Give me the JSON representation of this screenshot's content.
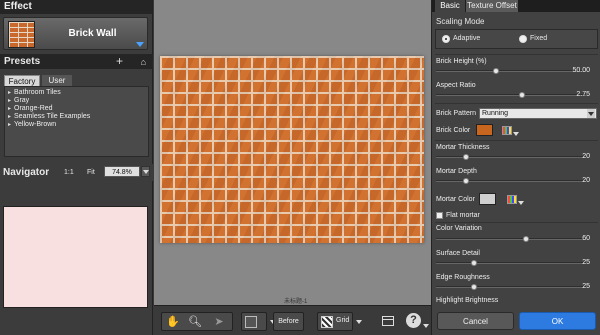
{
  "effect": {
    "section_title": "Effect",
    "name": "Brick Wall"
  },
  "presets": {
    "section_title": "Presets",
    "tabs": [
      "Factory",
      "User"
    ],
    "items": [
      "Bathroom Tiles",
      "Gray",
      "Orange-Red",
      "Seamless Tile Examples",
      "Yellow-Brown"
    ]
  },
  "navigator": {
    "title": "Navigator",
    "one_to_one": "1:1",
    "fit": "Fit",
    "zoom": "74.8%"
  },
  "canvas": {
    "label": "未标题-1"
  },
  "toolbar": {
    "before_label": "Before",
    "grid_label": "Grid",
    "help_label": "?"
  },
  "panel": {
    "tabs": [
      "Basic",
      "Texture Offset"
    ],
    "scaling_mode": {
      "title": "Scaling Mode",
      "options": [
        "Adaptive",
        "Fixed"
      ],
      "selected": "Adaptive"
    },
    "brick_height": {
      "label": "Brick Height (%)",
      "value": "50.00",
      "fraction": 0.4
    },
    "aspect_ratio": {
      "label": "Aspect Ratio",
      "value": "2.75",
      "fraction": 0.57
    },
    "brick_pattern": {
      "label": "Brick Pattern",
      "value": "Running"
    },
    "brick_color": {
      "label": "Brick Color",
      "color": "#c8661f"
    },
    "mortar_thickness": {
      "label": "Mortar Thickness",
      "value": "20",
      "fraction": 0.2
    },
    "mortar_depth": {
      "label": "Mortar Depth",
      "value": "20",
      "fraction": 0.2
    },
    "mortar_color": {
      "label": "Mortar Color",
      "color": "#d0d0d0"
    },
    "flat_mortar": {
      "label": "Flat mortar",
      "checked": false
    },
    "color_variation": {
      "label": "Color Variation",
      "value": "60",
      "fraction": 0.6
    },
    "surface_detail": {
      "label": "Surface Detail",
      "value": "25",
      "fraction": 0.25
    },
    "edge_roughness": {
      "label": "Edge Roughness",
      "value": "25",
      "fraction": 0.25
    },
    "highlight_brightness": {
      "label": "Highlight Brightness"
    }
  },
  "buttons": {
    "cancel": "Cancel",
    "ok": "OK"
  },
  "colors": {
    "accent": "#2d7be0",
    "navigator_bg": "#f8dfe0",
    "brick": "#cd6c2c",
    "mortar": "#e6cfb9"
  }
}
